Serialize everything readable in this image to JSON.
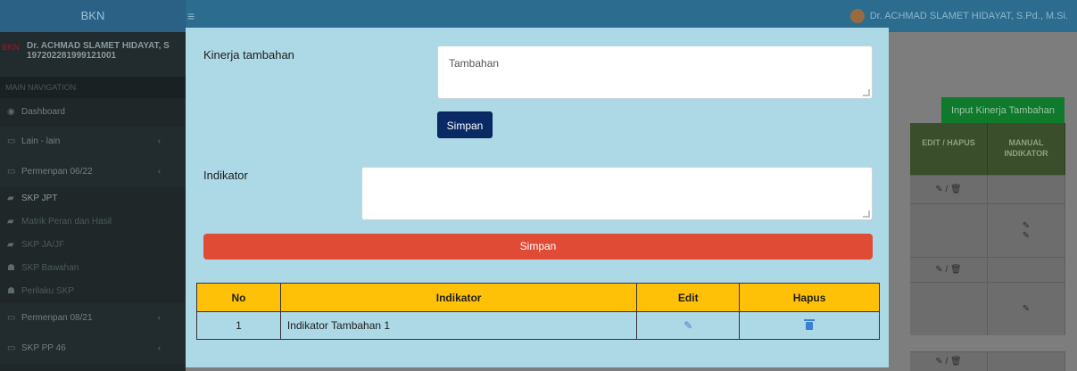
{
  "app": {
    "brand": "BKN",
    "top_user": "Dr. ACHMAD SLAMET HIDAYAT, S.Pd., M.Si."
  },
  "sidebar": {
    "user_name": "Dr. ACHMAD SLAMET HIDAYAT, S",
    "user_nip": "197202281999121001",
    "nav_header": "MAIN NAVIGATION",
    "items": [
      {
        "label": "Dashboard",
        "icon": "dashboard-icon"
      },
      {
        "label": "Lain - lain",
        "icon": "folder-icon"
      },
      {
        "label": "Permenpan 06/22",
        "icon": "folder-icon"
      },
      {
        "label": "SKP JPT",
        "icon": "book-icon"
      },
      {
        "label": "Matrik Peran dan Hasil",
        "icon": "book-icon"
      },
      {
        "label": "SKP JA/JF",
        "icon": "book-icon"
      },
      {
        "label": "SKP Bawahan",
        "icon": "users-icon"
      },
      {
        "label": "Perilaku SKP",
        "icon": "users-icon"
      },
      {
        "label": "Permenpan 08/21",
        "icon": "folder-icon"
      },
      {
        "label": "SKP PP 46",
        "icon": "folder-icon"
      }
    ]
  },
  "content": {
    "input_button": "Input Kinerja Tambahan",
    "col_edit_hapus": "EDIT / HAPUS",
    "col_manual": "MANUAL INDIKATOR",
    "edit_hapus_glyph": "✎ / 🗑"
  },
  "modal": {
    "kinerja_label": "Kinerja tambahan",
    "kinerja_value": "Tambahan",
    "simpan_small": "Simpan",
    "indikator_label": "Indikator",
    "indikator_value": "",
    "simpan_big": "Simpan",
    "table": {
      "headers": [
        "No",
        "Indikator",
        "Edit",
        "Hapus"
      ],
      "rows": [
        {
          "no": "1",
          "indikator": "Indikator Tambahan 1"
        }
      ]
    }
  },
  "colors": {
    "modal_bg": "#add8e6",
    "primary_button": "#0a2a66",
    "danger_button": "#e04b35",
    "table_header": "#ffc107",
    "success_button": "#0f7a2c"
  }
}
